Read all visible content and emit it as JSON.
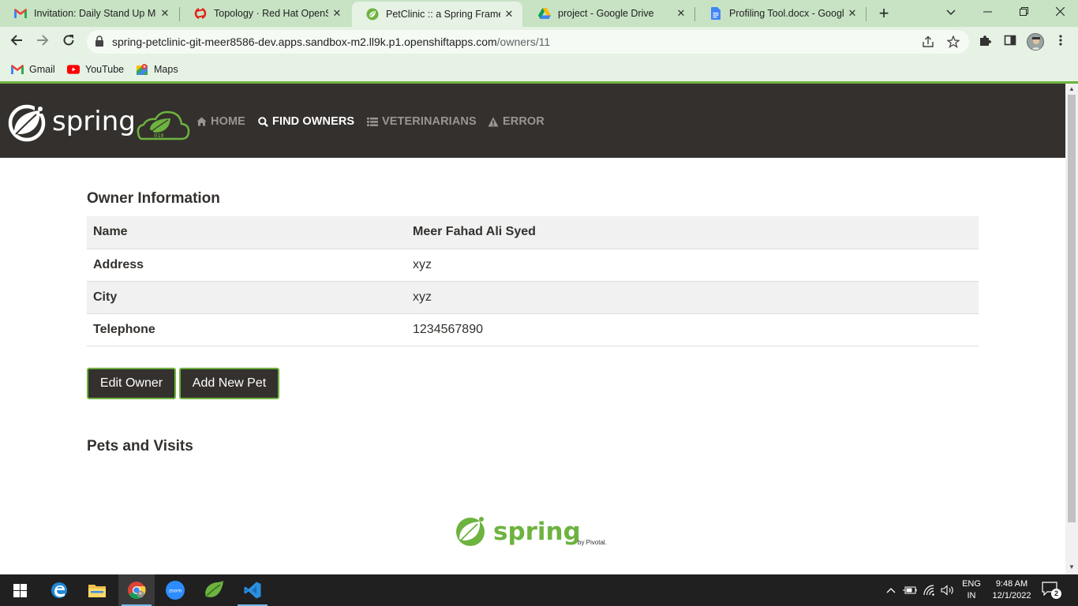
{
  "browser": {
    "tabs": [
      {
        "title": "Invitation: Daily Stand Up Me",
        "icon": "gmail-icon"
      },
      {
        "title": "Topology · Red Hat OpenShif",
        "icon": "openshift-icon"
      },
      {
        "title": "PetClinic :: a Spring Framewo",
        "icon": "spring-leaf-icon",
        "active": true
      },
      {
        "title": "project - Google Drive",
        "icon": "google-drive-icon"
      },
      {
        "title": "Profiling Tool.docx - Google",
        "icon": "google-docs-icon"
      }
    ],
    "address": {
      "host": "spring-petclinic-git-meer8586-dev.apps.sandbox-m2.ll9k.p1.openshiftapps.com",
      "path": "/owners/11"
    },
    "bookmarks": [
      {
        "label": "Gmail",
        "icon": "gmail-icon"
      },
      {
        "label": "YouTube",
        "icon": "youtube-icon"
      },
      {
        "label": "Maps",
        "icon": "maps-icon"
      }
    ],
    "theme_color": "#c7e3c4"
  },
  "app": {
    "brand": {
      "wordmark": "spring",
      "badge_text": "010"
    },
    "nav": {
      "home": "HOME",
      "find_owners": "FIND OWNERS",
      "veterinarians": "VETERINARIANS",
      "error": "ERROR"
    },
    "nav_active": "find_owners",
    "owner_section_title": "Owner Information",
    "owner": {
      "name_label": "Name",
      "name": "Meer Fahad Ali Syed",
      "address_label": "Address",
      "address": "xyz",
      "city_label": "City",
      "city": "xyz",
      "telephone_label": "Telephone",
      "telephone": "1234567890"
    },
    "buttons": {
      "edit_owner": "Edit Owner",
      "add_new_pet": "Add New Pet"
    },
    "pets_section_title": "Pets and Visits",
    "footer": {
      "wordmark": "spring",
      "byline": "by Pivotal."
    },
    "colors": {
      "navbar": "#34302d",
      "accent": "#6db33f",
      "inactive_nav": "#9b9592"
    }
  },
  "taskbar": {
    "apps": [
      "windows-start-icon",
      "edge-icon",
      "file-explorer-icon",
      "chrome-icon",
      "zoom-icon",
      "spring-tool-suite-icon",
      "vscode-icon"
    ],
    "language": {
      "line1": "ENG",
      "line2": "IN"
    },
    "time": "9:48 AM",
    "date": "12/1/2022",
    "notification_count": "2"
  }
}
